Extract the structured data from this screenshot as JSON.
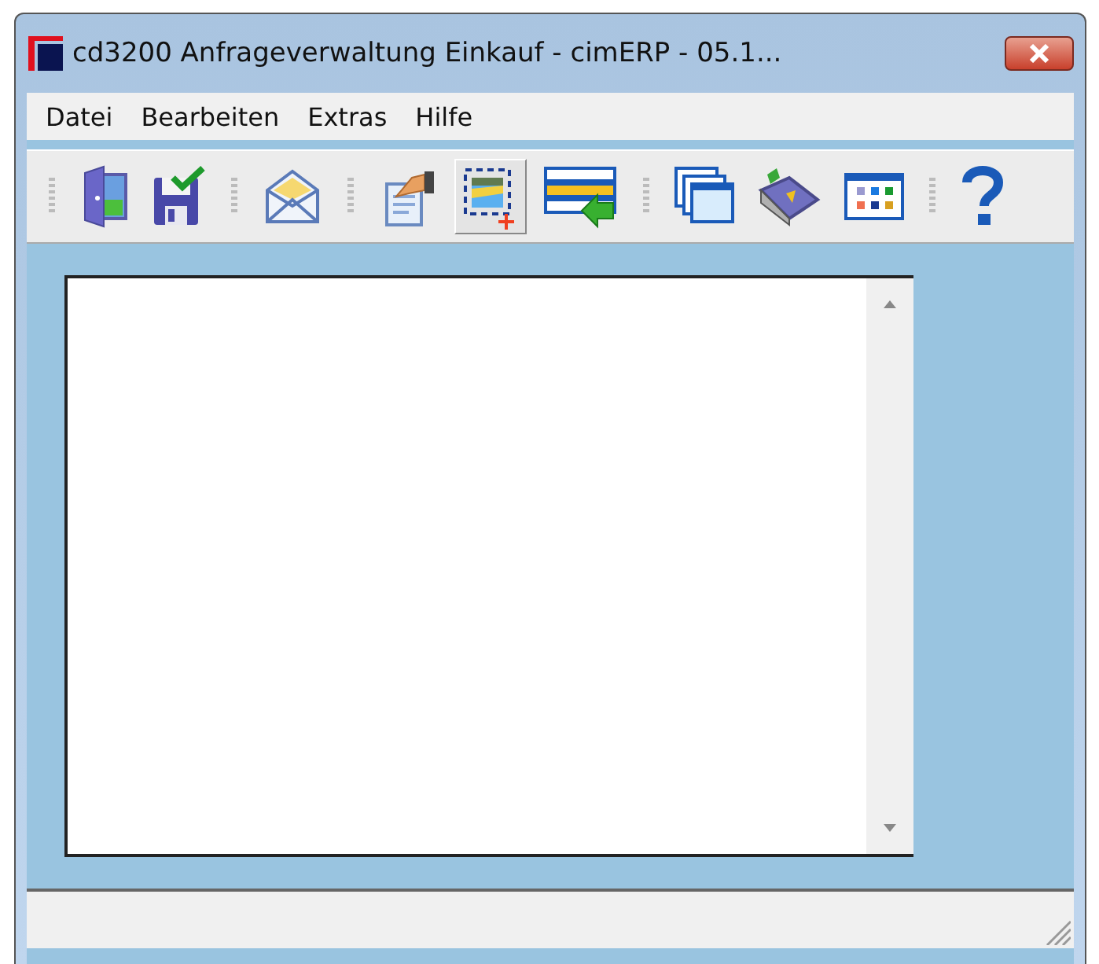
{
  "window": {
    "title": "cd3200 Anfrageverwaltung Einkauf - cimERP - 05.1..."
  },
  "menu": [
    "Datei",
    "Bearbeiten",
    "Extras",
    "Hilfe"
  ],
  "toolbar": [
    {
      "items": [
        {
          "kind": "door",
          "pressed": false
        },
        {
          "kind": "save",
          "pressed": false
        }
      ]
    },
    {
      "items": [
        {
          "kind": "mail",
          "pressed": false
        }
      ]
    },
    {
      "items": [
        {
          "kind": "document",
          "pressed": false
        },
        {
          "kind": "picture",
          "pressed": true
        },
        {
          "kind": "list",
          "pressed": false
        }
      ]
    },
    {
      "items": [
        {
          "kind": "windows",
          "pressed": false
        },
        {
          "kind": "book",
          "pressed": false
        },
        {
          "kind": "grid",
          "pressed": false
        }
      ]
    },
    {
      "items": [
        {
          "kind": "help",
          "pressed": false
        }
      ]
    }
  ]
}
